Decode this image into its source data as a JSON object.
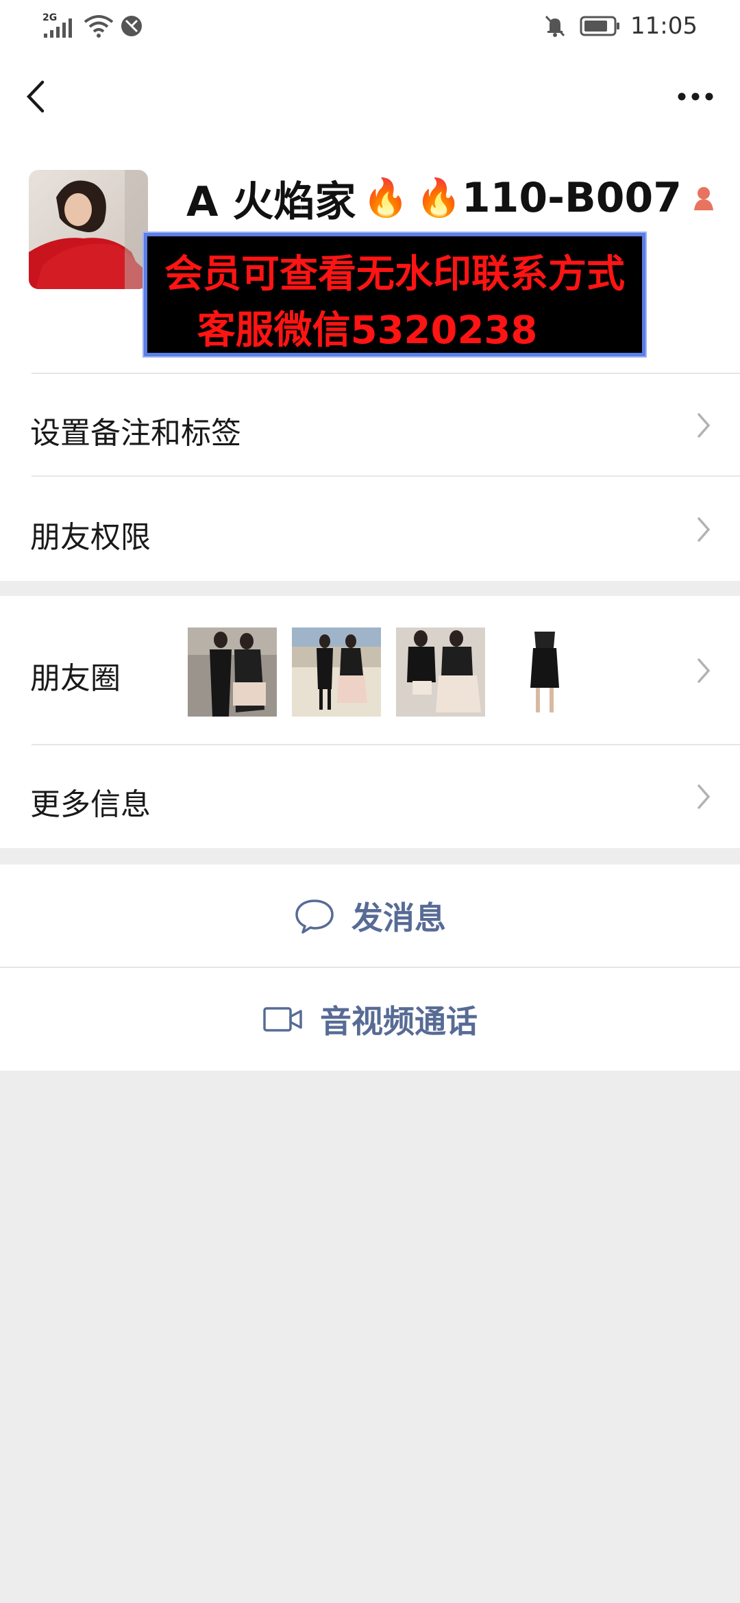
{
  "status_bar": {
    "network_type": "2G",
    "time": "11:05",
    "icons": [
      "signal-icon",
      "wifi-icon",
      "data-saver-icon",
      "mute-bell-icon",
      "battery-icon"
    ]
  },
  "nav": {
    "back_icon": "chevron-left-icon",
    "more_icon": "more-dots-icon"
  },
  "profile": {
    "name_prefix": "A 火焰家",
    "name_suffix": "110-B007",
    "flame_glyph": "🔥",
    "gender_icon": "female-icon",
    "promo_line1": "会员可查看无水印联系方式",
    "promo_line2": "客服微信5320238",
    "promo_text_color": "#ff1414",
    "promo_border_color": "#5b7fe6"
  },
  "rows": {
    "remark": "设置备注和标签",
    "permission": "朋友权限",
    "moments": "朋友圈",
    "more_info": "更多信息"
  },
  "actions": {
    "message": "发消息",
    "call": "音视频通话",
    "link_color": "#576b95"
  }
}
